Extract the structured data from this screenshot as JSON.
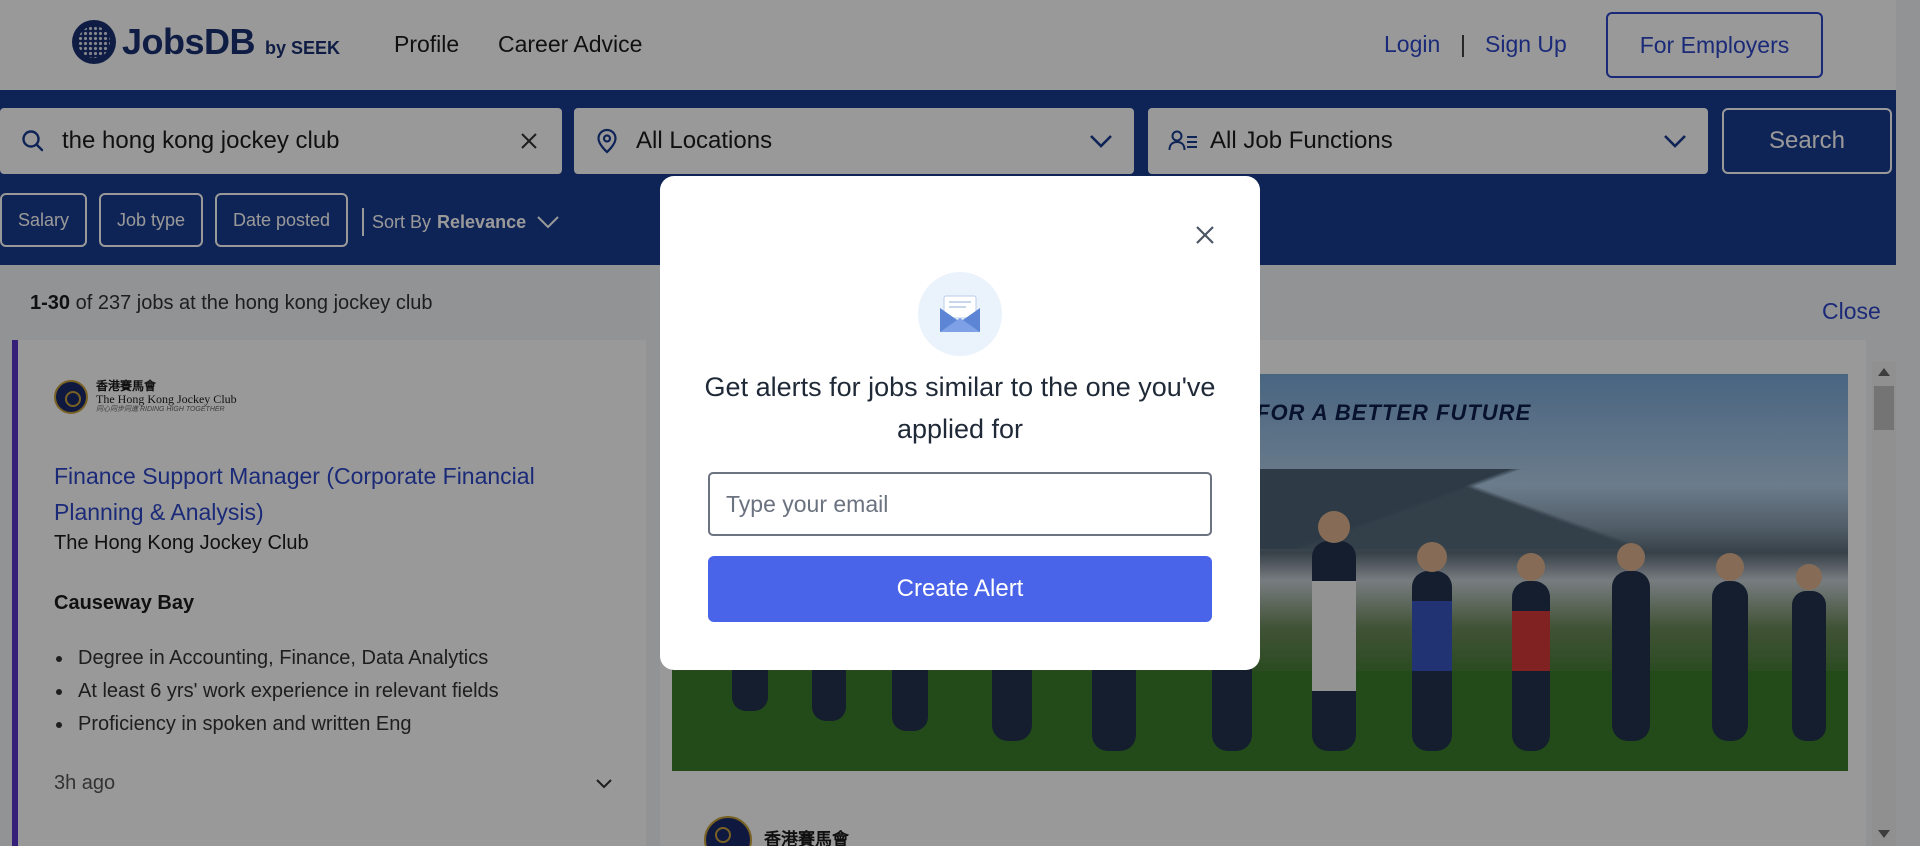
{
  "header": {
    "logo_name": "JobsDB",
    "logo_by": "by SEEK",
    "nav": [
      "Profile",
      "Career Advice"
    ],
    "login": "Login",
    "separator": "|",
    "signup": "Sign Up",
    "employers": "For Employers"
  },
  "search": {
    "keyword": "the hong kong jockey club",
    "location": "All Locations",
    "job_function": "All Job Functions",
    "button": "Search"
  },
  "filters": {
    "chips": [
      "Salary",
      "Job type",
      "Date posted"
    ],
    "sort_label": "Sort By",
    "sort_value": "Relevance"
  },
  "results": {
    "range": "1-30",
    "summary": "of 237 jobs at the hong kong jockey club",
    "close": "Close"
  },
  "job_card": {
    "logo_zh": "香港賽馬會",
    "logo_en": "The Hong Kong Jockey Club",
    "logo_tagline": "同心同步同進 RIDING HIGH TOGETHER",
    "title": "Finance Support Manager (Corporate Financial Planning & Analysis)",
    "company": "The Hong Kong Jockey Club",
    "location": "Causeway Bay",
    "bullets": [
      "Degree in Accounting, Finance, Data Analytics",
      "At least 6 yrs' work experience in relevant fields",
      "Proficiency in spoken and written Eng"
    ],
    "posted": "3h ago"
  },
  "detail": {
    "banner_text": "R FOR A BETTER FUTURE",
    "logo_zh": "香港賽馬會"
  },
  "modal": {
    "heading": "Get alerts for jobs similar to the one you've applied for",
    "email_placeholder": "Type your email",
    "email_value": "",
    "button": "Create Alert"
  },
  "colors": {
    "brand_navy": "#1a3c8f",
    "link_blue": "#2e47c9",
    "alert_button": "#4964e9",
    "card_accent": "#5b34c8"
  },
  "icons": [
    "search-icon",
    "clear-icon",
    "location-pin-icon",
    "chevron-down-icon",
    "job-function-icon",
    "close-icon",
    "mail-icon"
  ]
}
